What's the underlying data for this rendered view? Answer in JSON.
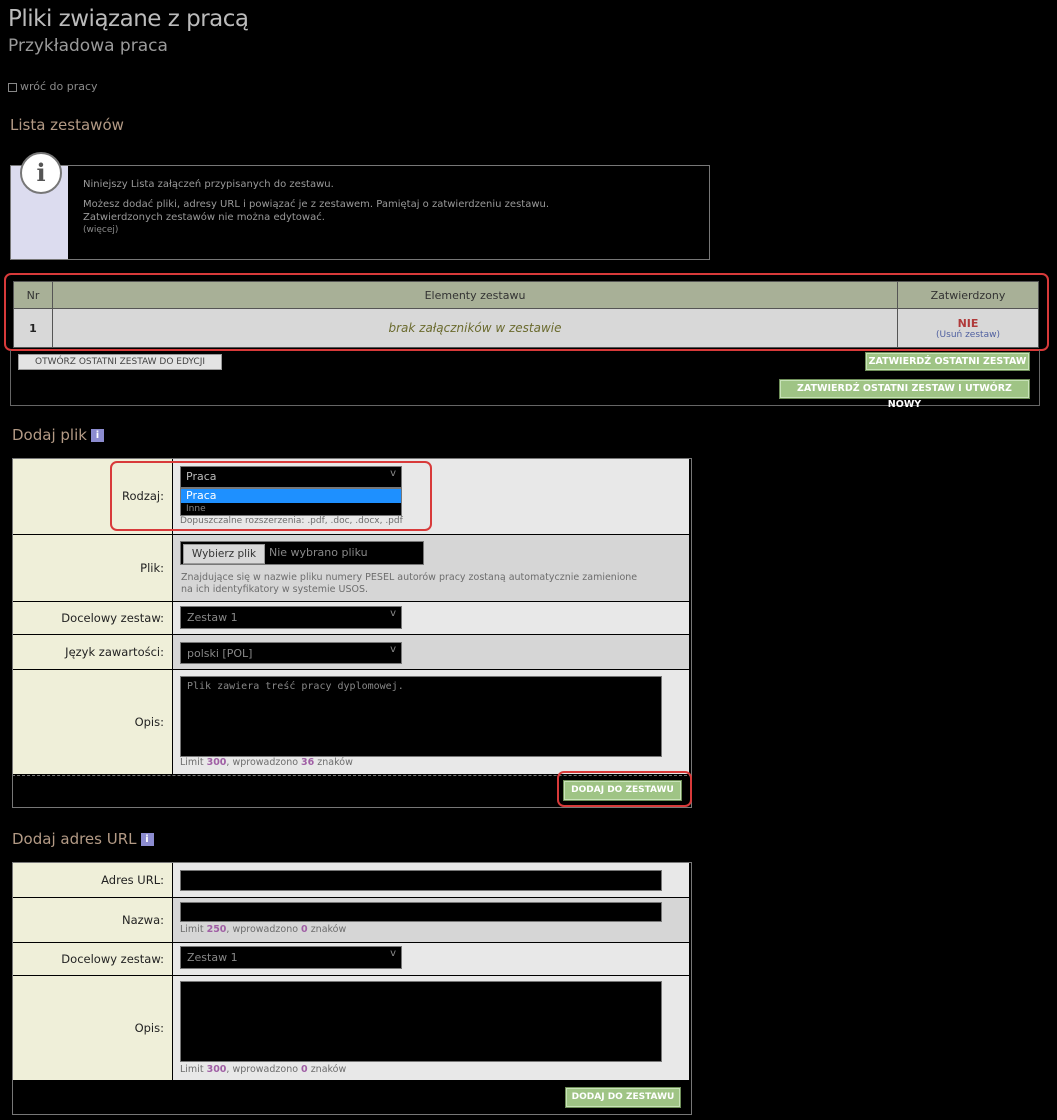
{
  "page": {
    "title": "Pliki związane z pracą",
    "subtitle": "Przykładowa praca",
    "back_link": "wróć do pracy"
  },
  "sets_section": {
    "title": "Lista zestawów",
    "info_line1": "Niniejszy Lista załączeń przypisanych do zestawu.",
    "info_line2": "Możesz dodać pliki, adresy URL i powiązać je z zestawem. Pamiętaj o zatwierdzeniu zestawu.",
    "info_line3": "Zatwierdzonych zestawów nie można edytować.",
    "info_more": "(więcej)",
    "columns": [
      "Nr",
      "Elementy zestawu",
      "Zatwierdzony"
    ],
    "rows": [
      {
        "nr": "1",
        "elements": "brak załączników w zestawie",
        "approved": "NIE",
        "action": "(Usuń zestaw)"
      }
    ],
    "btn_open_edit": "OTWÓRZ OSTATNI ZESTAW DO EDYCJI",
    "btn_approve": "ZATWIERDŹ OSTATNI ZESTAW",
    "btn_approve_new": "ZATWIERDŹ OSTATNI ZESTAW I UTWÓRZ NOWY"
  },
  "add_file": {
    "title": "Dodaj plik",
    "info_badge": "i",
    "type_label": "Rodzaj:",
    "type_value": "Praca",
    "type_options": [
      "Praca",
      "Inne"
    ],
    "type_hint": "Dopuszczalne rozszerzenia: .pdf, .doc, .docx, .pdf",
    "file_label": "Plik:",
    "file_button": "Wybierz plik",
    "file_none": "Nie wybrano pliku",
    "file_hint": "Znajdujące się w nazwie pliku numery PESEL autorów pracy zostaną automatycznie zamienione na ich identyfikatory w systemie USOS.",
    "target_label": "Docelowy zestaw:",
    "target_value": "Zestaw 1",
    "lang_label": "Język zawartości:",
    "lang_value": "polski [POL]",
    "desc_label": "Opis:",
    "desc_value": "Plik zawiera treść pracy dyplomowej.",
    "desc_limit_pre": "Limit ",
    "desc_limit": "300",
    "desc_count_pre": ", wprowadzono ",
    "desc_count": "36",
    "desc_count_post": " znaków",
    "submit": "DODAJ DO ZESTAWU"
  },
  "add_url": {
    "title": "Dodaj adres URL",
    "info_badge": "i",
    "url_label": "Adres URL:",
    "name_label": "Nazwa:",
    "name_limit_pre": "Limit ",
    "name_limit": "250",
    "name_count_pre": ", wprowadzono ",
    "name_count": "0",
    "name_count_post": " znaków",
    "target_label": "Docelowy zestaw:",
    "target_value": "Zestaw 1",
    "desc_label": "Opis:",
    "desc_limit_pre": "Limit ",
    "desc_limit": "300",
    "desc_count_pre": ", wprowadzono ",
    "desc_count": "0",
    "desc_count_post": " znaków",
    "submit": "DODAJ DO ZESTAWU"
  },
  "colors": {
    "header_bg": "#a8b097",
    "label_bg": "#efefd9",
    "green_button": "#9fc485",
    "highlight_red": "#d83a3a",
    "no_status": "#b03a3a"
  }
}
